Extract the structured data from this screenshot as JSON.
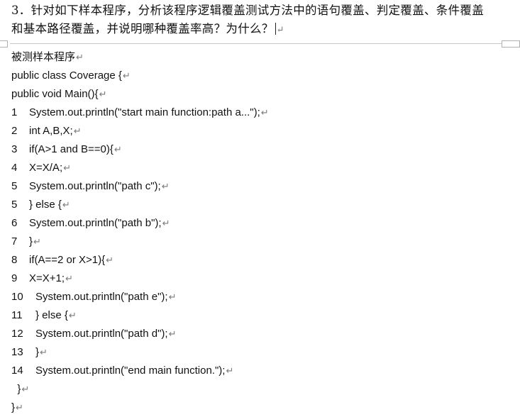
{
  "question": {
    "line1": "3．针对如下样本程序，分析该程序逻辑覆盖测试方法中的语句覆盖、判定覆盖、条件覆盖",
    "line2": "和基本路径覆盖，并说明哪种覆盖率高？为什么？"
  },
  "paragraph_mark": "↵",
  "code": {
    "heading": "被测样本程序",
    "class_line": "public class Coverage {",
    "method_line": "public void Main(){",
    "numbered": [
      {
        "num": "1",
        "text": "System.out.println(\"start main function:path a...\");"
      },
      {
        "num": "2",
        "text": "int A,B,X;"
      },
      {
        "num": "3",
        "text": "if(A>1 and B==0){"
      },
      {
        "num": "4",
        "text": "X=X/A;"
      },
      {
        "num": "5",
        "text": "System.out.println(\"path c\");"
      },
      {
        "num": "5",
        "text": "} else {"
      },
      {
        "num": "6",
        "text": "System.out.println(\"path b\");"
      },
      {
        "num": "7",
        "text": "}"
      },
      {
        "num": "8",
        "text": "if(A==2 or X>1){"
      },
      {
        "num": "9",
        "text": "X=X+1;"
      },
      {
        "num": "10",
        "text": "System.out.println(\"path e\");"
      },
      {
        "num": "11",
        "text": "} else {"
      },
      {
        "num": "12",
        "text": "System.out.println(\"path d\");"
      },
      {
        "num": "13",
        "text": "}"
      },
      {
        "num": "14",
        "text": "System.out.println(\"end main function.\");"
      }
    ],
    "close1": "}",
    "close2": "}"
  }
}
